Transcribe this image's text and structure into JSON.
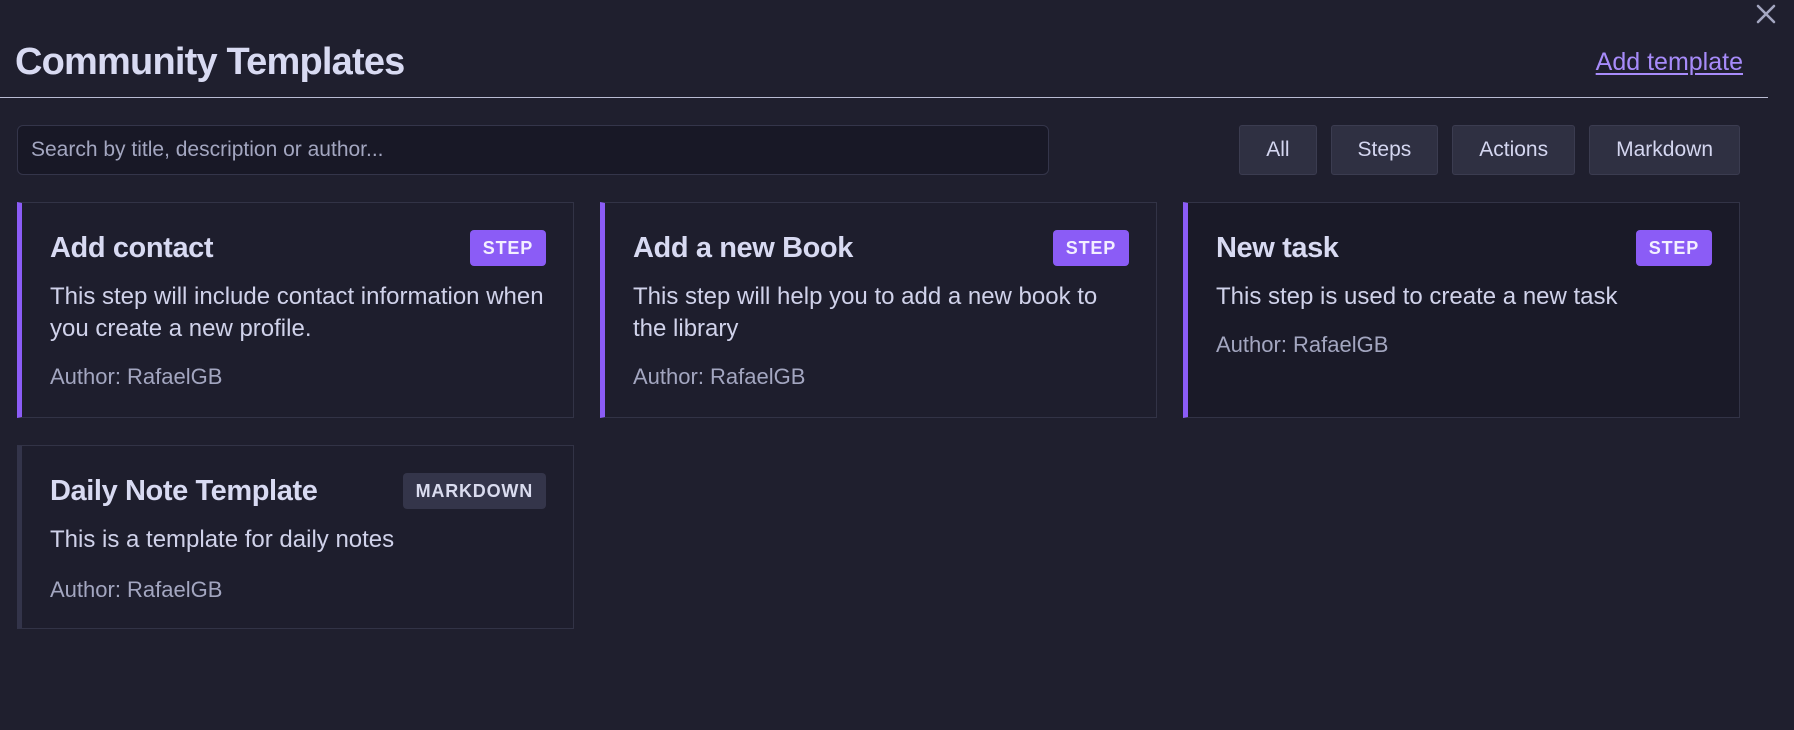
{
  "header": {
    "title": "Community Templates",
    "add_template_label": "Add template"
  },
  "search": {
    "placeholder": "Search by title, description or author..."
  },
  "filters": [
    "All",
    "Steps",
    "Actions",
    "Markdown"
  ],
  "cards": [
    {
      "title": "Add contact",
      "badge": "STEP",
      "description": "This step will include contact information when you create a new profile.",
      "author": "Author: RafaelGB"
    },
    {
      "title": "Add a new Book",
      "badge": "STEP",
      "description": "This step will help you to add a new book to the library",
      "author": "Author: RafaelGB"
    },
    {
      "title": "New task",
      "badge": "STEP",
      "description": "This step is used to create a new task",
      "author": "Author: RafaelGB"
    },
    {
      "title": "Daily Note Template",
      "badge": "MARKDOWN",
      "description": "This is a template for daily notes",
      "author": "Author: RafaelGB"
    }
  ],
  "colors": {
    "background": "#1f1f2e",
    "accent": "#8b5cf6",
    "link": "#a78bfa",
    "text": "#d4d6f0",
    "muted_text": "#a3a6c0"
  },
  "icons": {
    "close": "close-icon"
  }
}
